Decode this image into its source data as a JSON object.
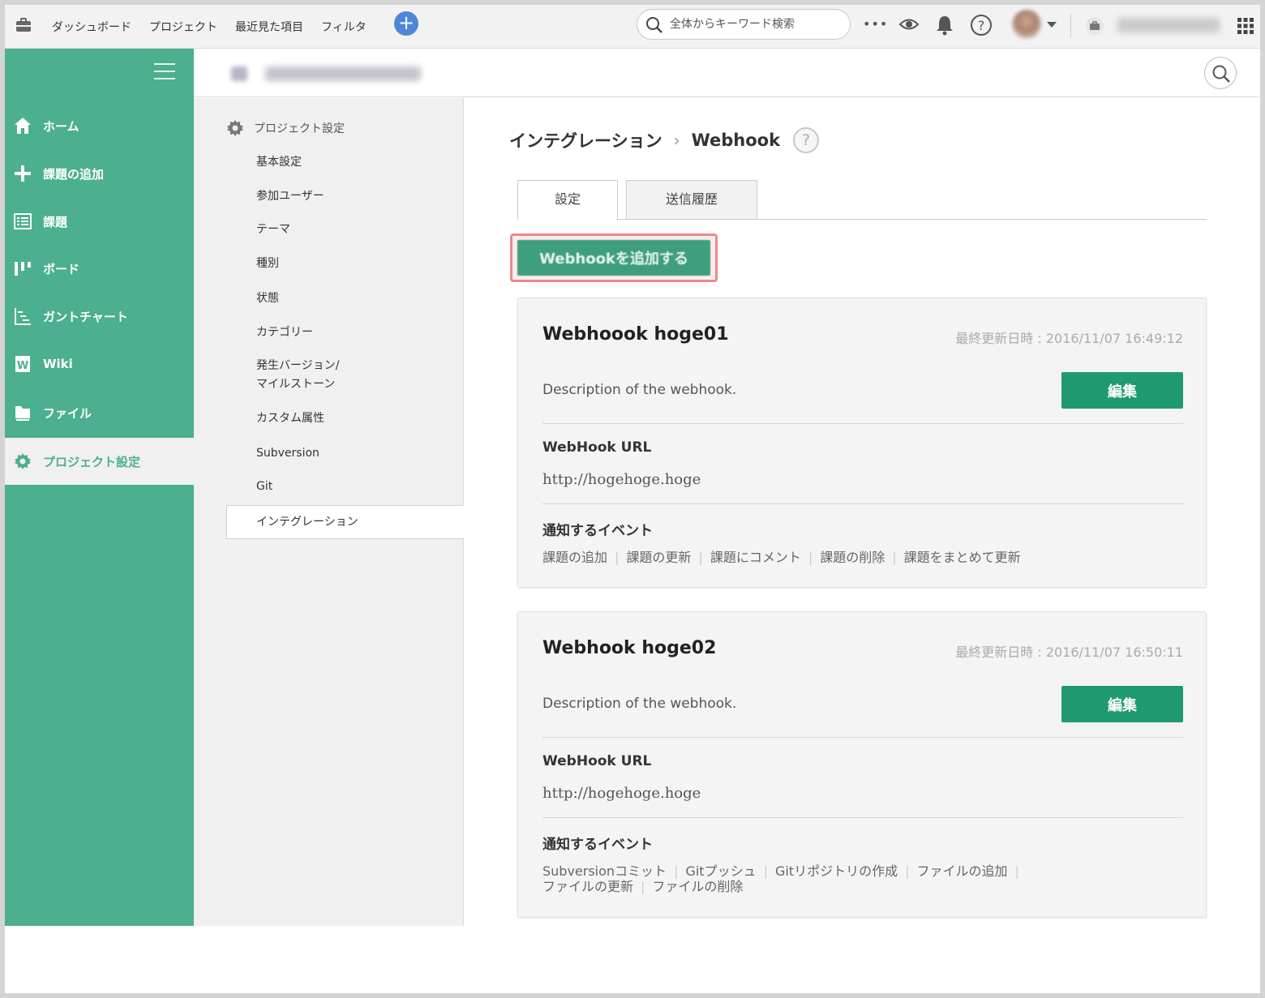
{
  "topbar": {
    "nav": [
      "ダッシュボード",
      "プロジェクト",
      "最近見た項目",
      "フィルタ"
    ],
    "add_label": "+",
    "search_placeholder": "全体からキーワード検索",
    "more_label": "•••"
  },
  "sidebar": {
    "items": [
      {
        "label": "ホーム",
        "icon": "home-icon"
      },
      {
        "label": "課題の追加",
        "icon": "plus-icon"
      },
      {
        "label": "課題",
        "icon": "list-icon"
      },
      {
        "label": "ボード",
        "icon": "board-icon"
      },
      {
        "label": "ガントチャート",
        "icon": "gantt-icon"
      },
      {
        "label": "Wiki",
        "icon": "wiki-icon"
      },
      {
        "label": "ファイル",
        "icon": "file-icon"
      },
      {
        "label": "プロジェクト設定",
        "icon": "gear-icon"
      }
    ],
    "active_index": 7
  },
  "settings_nav": {
    "title": "プロジェクト設定",
    "items": [
      "基本設定",
      "参加ユーザー",
      "テーマ",
      "種別",
      "状態",
      "カテゴリー",
      "発生バージョン/",
      "マイルストーン",
      "カスタム属性",
      "Subversion",
      "Git"
    ],
    "active": "インテグレーション"
  },
  "breadcrumb": {
    "parent": "インテグレーション",
    "separator": "›",
    "current": "Webhook",
    "help": "?"
  },
  "tabs": [
    {
      "label": "設定",
      "active": true
    },
    {
      "label": "送信履歴",
      "active": false
    }
  ],
  "add_webhook_label": "Webhookを追加する",
  "webhooks": [
    {
      "name": "Webhoook hoge01",
      "updated": "最終更新日時 : 2016/11/07 16:49:12",
      "description": "Description of the webhook.",
      "edit_label": "編集",
      "url_label": "WebHook URL",
      "url": "http://hogehoge.hoge",
      "events_label": "通知するイベント",
      "events": [
        "課題の追加",
        "課題の更新",
        "課題にコメント",
        "課題の削除",
        "課題をまとめて更新"
      ]
    },
    {
      "name": "Webhook hoge02",
      "updated": "最終更新日時 : 2016/11/07 16:50:11",
      "description": "Description of the webhook.",
      "edit_label": "編集",
      "url_label": "WebHook URL",
      "url": "http://hogehoge.hoge",
      "events_label": "通知するイベント",
      "events": [
        "Subversionコミット",
        "Gitプッシュ",
        "Gitリポジトリの作成",
        "ファイルの追加",
        "ファイルの更新",
        "ファイルの削除"
      ]
    }
  ],
  "colors": {
    "sidebar": "#4caf8f",
    "edit_button": "#1f9a70",
    "add_button": "#3f9e7d",
    "highlight": "#ec8a8a"
  }
}
